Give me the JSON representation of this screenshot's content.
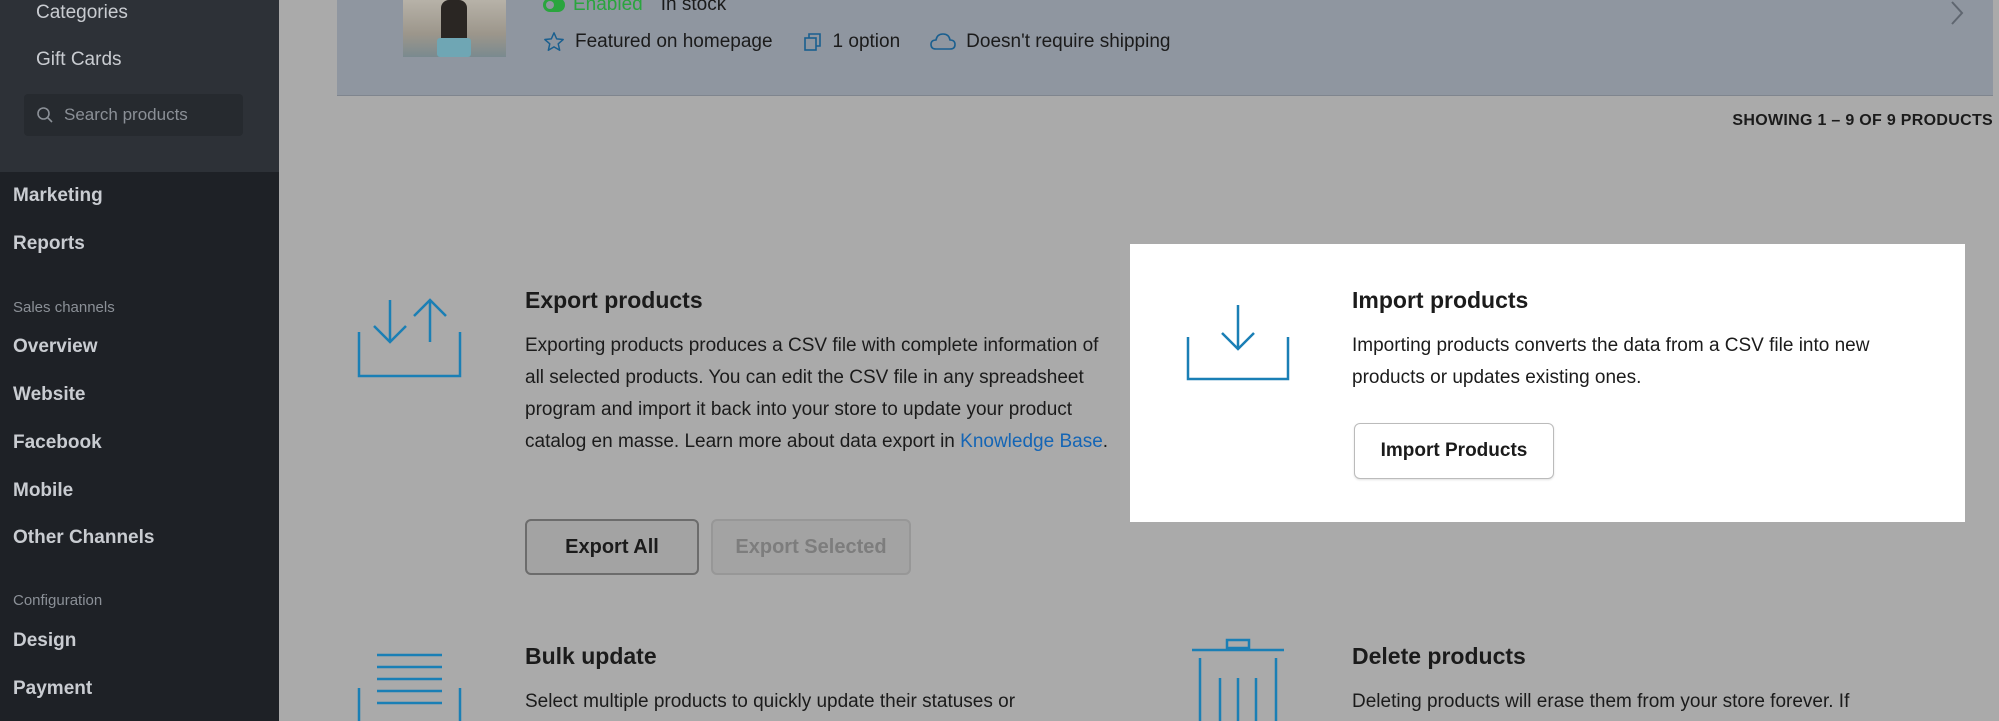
{
  "sidebar": {
    "sub_items": [
      "Categories",
      "Gift Cards"
    ],
    "search": {
      "placeholder": "Search products"
    },
    "nav_main": [
      "Marketing",
      "Reports"
    ],
    "sales_channels": {
      "heading": "Sales channels",
      "items": [
        "Overview",
        "Website",
        "Facebook",
        "Mobile",
        "Other Channels"
      ]
    },
    "configuration": {
      "heading": "Configuration",
      "items": [
        "Design",
        "Payment"
      ]
    }
  },
  "product": {
    "status": "Enabled",
    "stock": "In stock",
    "meta": [
      {
        "icon": "star-icon",
        "label": "Featured on homepage"
      },
      {
        "icon": "copy-icon",
        "label": "1 option"
      },
      {
        "icon": "cloud-icon",
        "label": "Doesn't require shipping"
      }
    ]
  },
  "pagination": {
    "showing": "SHOWING 1 – 9 OF 9 PRODUCTS"
  },
  "export": {
    "title": "Export products",
    "text_before_link": "Exporting products produces a CSV file with complete information of all selected products. You can edit the CSV file in any spreadsheet program and import it back into your store to update your product catalog en masse. Learn more about data export in ",
    "link": "Knowledge Base",
    "text_after_link": ".",
    "btn_all": "Export All",
    "btn_selected": "Export Selected"
  },
  "import": {
    "title": "Import products",
    "text": "Importing products converts the data from a CSV file into new products or updates existing ones.",
    "btn": "Import Products"
  },
  "bulk": {
    "title": "Bulk update",
    "text": "Select multiple products to quickly update their statuses or"
  },
  "delete": {
    "title": "Delete products",
    "text": "Deleting products will erase them from your store forever. If"
  },
  "colors": {
    "accent_icon": "#1a7fb5",
    "link": "#1465b5",
    "enabled": "#2aa53e",
    "sidebar_bg": "#1e2126"
  }
}
